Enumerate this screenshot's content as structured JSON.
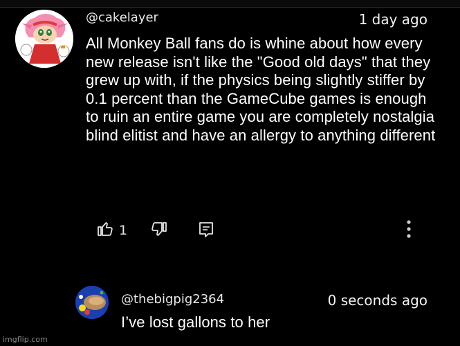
{
  "comments": [
    {
      "handle": "@cakelayer",
      "time": "1 day ago",
      "text": "All Monkey Ball fans do is whine about how every new release isn't like the \"Good old days\" that they grew up with, if the physics being slightly stiffer by 0.1 percent than the GameCube games is enough to ruin an entire game you are completely nostalgia blind elitist and have an allergy to anything different",
      "like_count": "1",
      "avatar": "amy-rose-avatar"
    },
    {
      "handle": "@thebigpig2364",
      "time": "0 seconds ago",
      "text": "I’ve lost gallons to her",
      "avatar": "blue-avatar"
    }
  ],
  "icons": {
    "like": "thumbs-up-icon",
    "dislike": "thumbs-down-icon",
    "reply": "reply-icon",
    "more": "more-vert-icon"
  },
  "colors": {
    "background": "#000000",
    "text": "#ffffff",
    "secondary": "#cfcfcf"
  },
  "watermark": "imgflip.com"
}
